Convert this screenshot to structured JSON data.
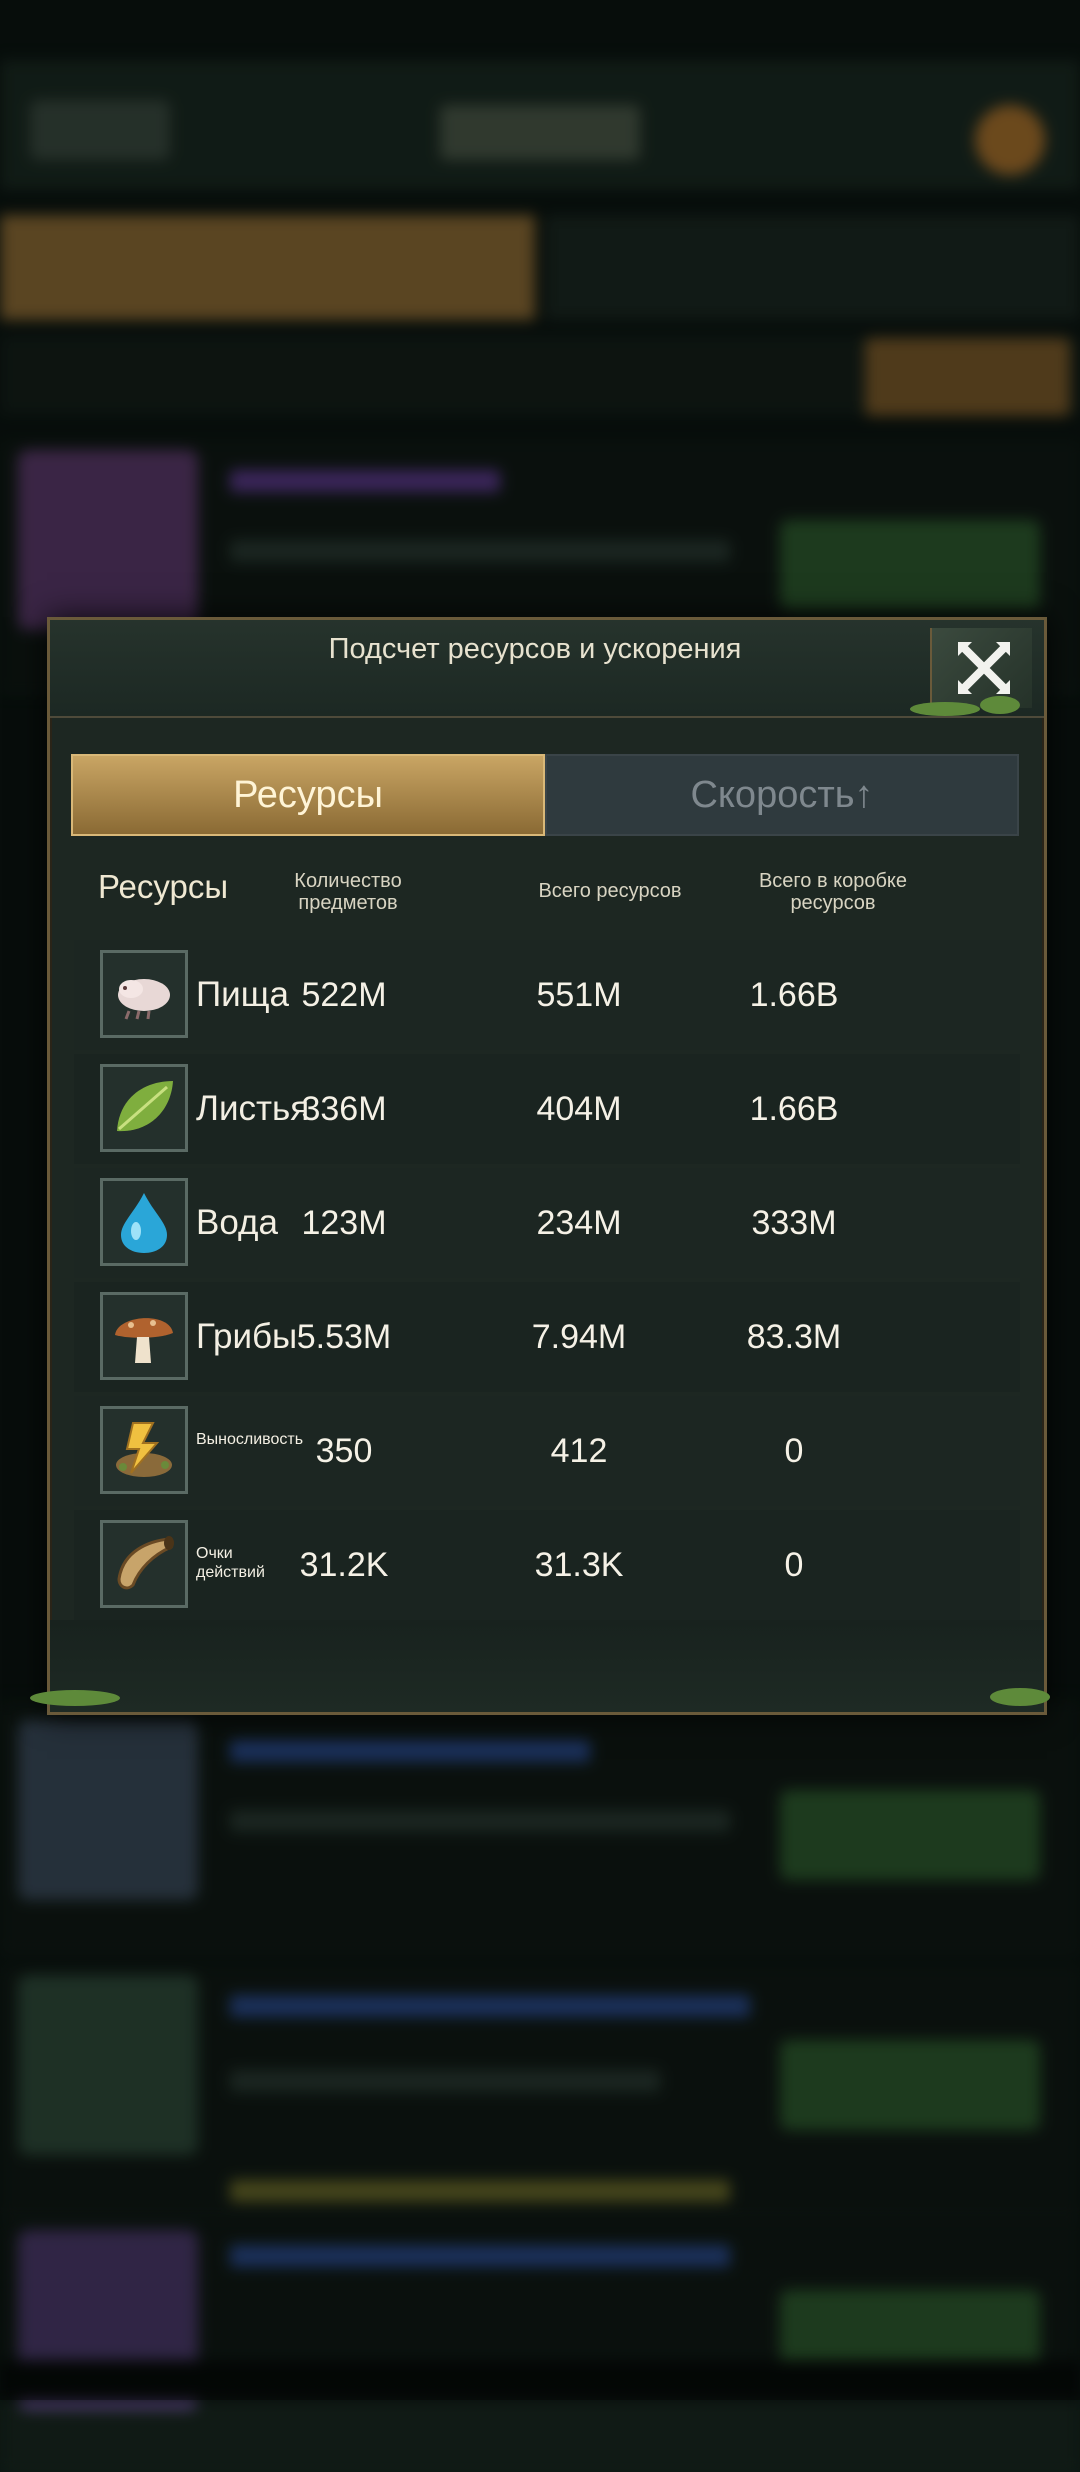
{
  "modal": {
    "title": "Подсчет ресурсов и ускорения"
  },
  "tabs": {
    "resources": "Ресурсы",
    "speedups": "Скорость↑"
  },
  "columns": {
    "resource": "Ресурсы",
    "item_count": "Количество предметов",
    "total_resources": "Всего ресурсов",
    "total_in_box": "Всего в коробке ресурсов"
  },
  "rows": [
    {
      "icon": "larva-icon",
      "name": "Пища",
      "items": "522M",
      "total": "551M",
      "box": "1.66B"
    },
    {
      "icon": "leaf-icon",
      "name": "Листья",
      "items": "336M",
      "total": "404M",
      "box": "1.66B"
    },
    {
      "icon": "water-drop-icon",
      "name": "Вода",
      "items": "123M",
      "total": "234M",
      "box": "333M"
    },
    {
      "icon": "mushroom-icon",
      "name": "Грибы",
      "items": "5.53M",
      "total": "7.94M",
      "box": "83.3M"
    },
    {
      "icon": "stamina-icon",
      "name": "Выносливость",
      "items": "350",
      "total": "412",
      "box": "0"
    },
    {
      "icon": "horn-icon",
      "name": "Очки действий",
      "items": "31.2K",
      "total": "31.3K",
      "box": "0"
    }
  ],
  "colors": {
    "accent_gold": "#c9a564",
    "panel": "#1d2722",
    "text": "#f5f1e6"
  }
}
